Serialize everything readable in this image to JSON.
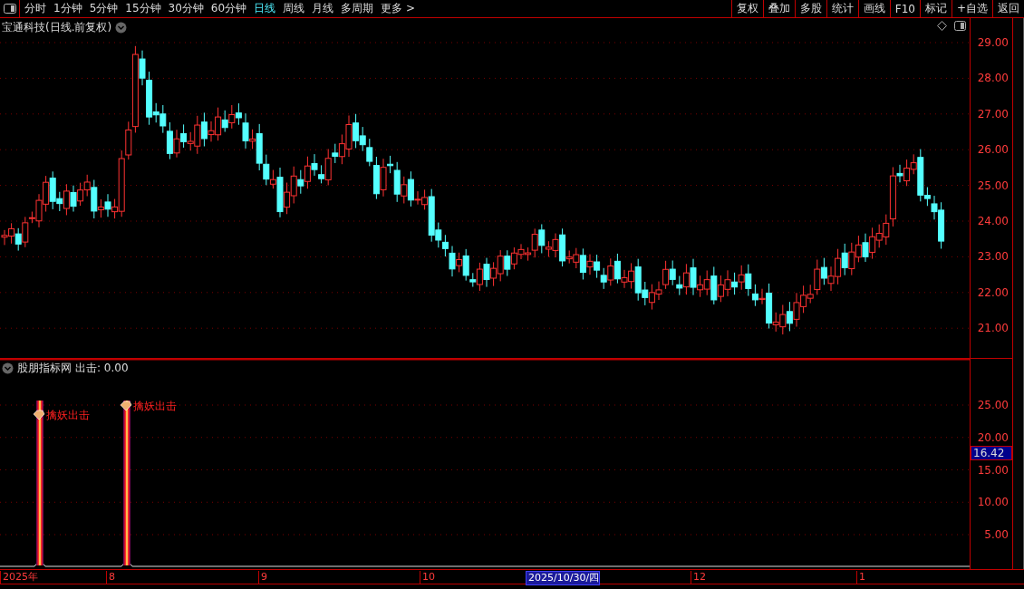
{
  "toolbar": {
    "periods": [
      {
        "label": "分时",
        "selected": false
      },
      {
        "label": "1分钟",
        "selected": false
      },
      {
        "label": "5分钟",
        "selected": false
      },
      {
        "label": "15分钟",
        "selected": false
      },
      {
        "label": "30分钟",
        "selected": false
      },
      {
        "label": "60分钟",
        "selected": false
      },
      {
        "label": "日线",
        "selected": true
      },
      {
        "label": "周线",
        "selected": false
      },
      {
        "label": "月线",
        "selected": false
      },
      {
        "label": "多周期",
        "selected": false
      },
      {
        "label": "更多 >",
        "selected": false
      }
    ],
    "actions": [
      "复权",
      "叠加",
      "多股",
      "统计",
      "画线",
      "F10",
      "标记",
      "+自选",
      "返回"
    ]
  },
  "price_panel": {
    "title": "宝通科技(日线.前复权)",
    "axis_labels": [
      "29.00",
      "28.00",
      "27.00",
      "26.00",
      "25.00",
      "24.00",
      "23.00",
      "22.00",
      "21.00"
    ]
  },
  "indicator_panel": {
    "title": "股朋指标网",
    "value_label": "出击: 0.00",
    "signals": [
      {
        "label": "擒妖出击"
      },
      {
        "label": "擒妖出击"
      }
    ],
    "axis_labels": [
      "25.00",
      "20.00",
      "15.00",
      "10.00",
      "5.00"
    ],
    "cursor_value": "16.42"
  },
  "date_axis": {
    "labels": [
      {
        "text": "2025年",
        "selected": false
      },
      {
        "text": "8",
        "selected": false
      },
      {
        "text": "9",
        "selected": false
      },
      {
        "text": "10",
        "selected": false
      },
      {
        "text": "2025/10/30/四",
        "selected": true
      },
      {
        "text": "12",
        "selected": false
      },
      {
        "text": "1",
        "selected": false
      }
    ]
  }
}
